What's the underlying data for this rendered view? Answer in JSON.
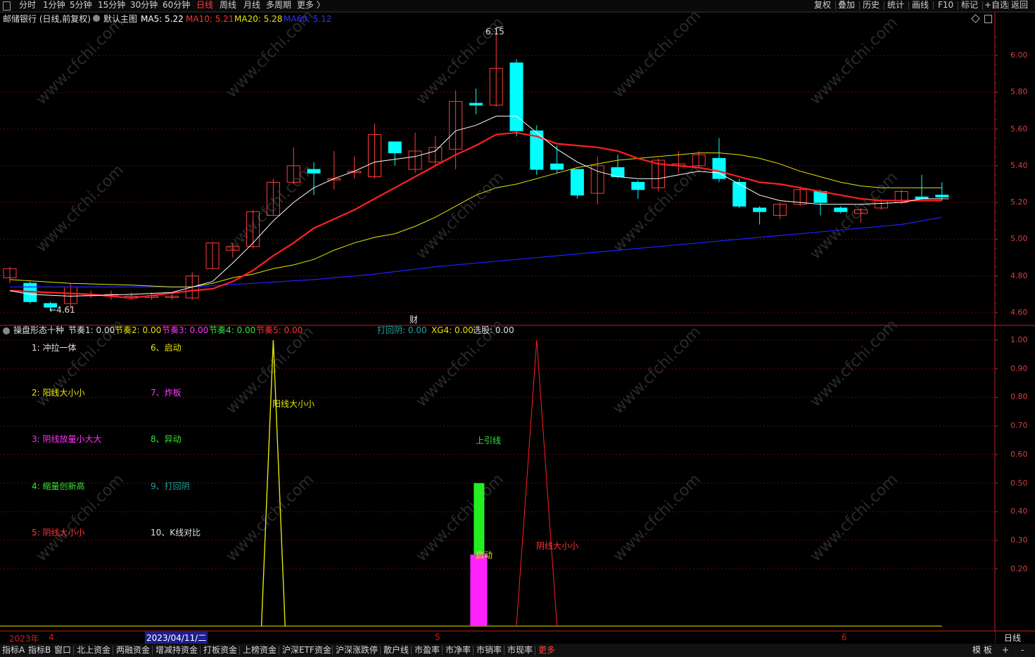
{
  "toolbar": {
    "periods": [
      "分时",
      "1分钟",
      "5分钟",
      "15分钟",
      "30分钟",
      "60分钟",
      "日线",
      "周线",
      "月线",
      "多周期",
      "更多 〉"
    ],
    "active_period": "日线",
    "right_buttons": [
      "复权",
      "叠加",
      "历史",
      "统计",
      "画线",
      "F10",
      "标记",
      "+自选",
      "返回"
    ]
  },
  "main_chart": {
    "stock_title": "邮储银行 (日线,前复权)",
    "template": "默认主图",
    "ma5": "MA5: 5.22",
    "ma10": "MA10: 5.21",
    "ma20": "MA20: 5.28",
    "ma60": "MA60: 5.12",
    "high_mark": "6.15",
    "low_mark": "4.61",
    "fin_marker": "财"
  },
  "indicator": {
    "title": "操盘形态十种",
    "jz1": "节奏1: 0.00",
    "jz2": "节奏2: 0.00",
    "jz3": "节奏3: 0.00",
    "jz4": "节奏4: 0.00",
    "jz5": "节奏5: 0.00",
    "dhy": "打回阴: 0.00",
    "xg4": "XG4: 0.00",
    "xg": "选股: 0.00",
    "legend": [
      {
        "text": "1: 冲拉一体",
        "color": "#e0e0e0"
      },
      {
        "text": "2: 阳线大小小",
        "color": "#e6e600"
      },
      {
        "text": "3: 阴线放量小大大",
        "color": "#ff33ff"
      },
      {
        "text": "4: 缩量创新高",
        "color": "#33e633"
      },
      {
        "text": "5: 阴线大小小",
        "color": "#ff3333"
      },
      {
        "text": "6、启动",
        "color": "#e6e600"
      },
      {
        "text": "7、炸板",
        "color": "#ff33ff"
      },
      {
        "text": "8、异动",
        "color": "#33e633"
      },
      {
        "text": "9、打回阴",
        "color": "#20a0a0"
      },
      {
        "text": "10、K线对比",
        "color": "#e0e0e0"
      }
    ],
    "signals": {
      "yang": "阳线大小小",
      "shangyin": "上引线",
      "qidong": "启动",
      "yin": "阴线大小小"
    }
  },
  "axes": {
    "price_ticks": [
      "6.00",
      "5.80",
      "5.60",
      "5.40",
      "5.20",
      "5.00",
      "4.80",
      "4.60"
    ],
    "ind_ticks": [
      "1.00",
      "0.90",
      "0.80",
      "0.70",
      "0.60",
      "0.50",
      "0.40",
      "0.30",
      "0.20"
    ]
  },
  "date_axis": {
    "year": "2023年",
    "m4": "4",
    "cursor_date": "2023/04/11/二",
    "m5": "5",
    "m6": "6",
    "period_label": "日线"
  },
  "bottom_tabs": [
    "指标A",
    "指标B",
    "窗口",
    "北上资金",
    "两融资金",
    "增减持资金",
    "打板资金",
    "上榜资金",
    "沪深ETF资金",
    "沪深涨跌停",
    "散户线",
    "市盈率",
    "市净率",
    "市销率",
    "市现率",
    "更多"
  ],
  "bottom_right": [
    "模 板",
    "+",
    "-"
  ],
  "watermark": "www.cfchi.com",
  "colors": {
    "bull": "#ff3c3c",
    "bear": "#00ffff",
    "ma5": "#ffffff",
    "ma10": "#ff2020",
    "ma20": "#e6e600",
    "ma60": "#2020ff",
    "axis": "#c81e1e"
  },
  "chart_data": [
    {
      "type": "candlestick",
      "title": "邮储银行 (日线,前复权)",
      "ylim": [
        4.55,
        6.2
      ],
      "candles": [
        {
          "o": 4.79,
          "c": 4.84,
          "h": 4.85,
          "l": 4.76
        },
        {
          "o": 4.76,
          "c": 4.66,
          "h": 4.77,
          "l": 4.65
        },
        {
          "o": 4.65,
          "c": 4.63,
          "h": 4.66,
          "l": 4.61
        },
        {
          "o": 4.65,
          "c": 4.74,
          "h": 4.76,
          "l": 4.62
        },
        {
          "o": 4.7,
          "c": 4.7,
          "h": 4.72,
          "l": 4.68
        },
        {
          "o": 4.69,
          "c": 4.7,
          "h": 4.72,
          "l": 4.67
        },
        {
          "o": 4.68,
          "c": 4.69,
          "h": 4.71,
          "l": 4.67
        },
        {
          "o": 4.69,
          "c": 4.69,
          "h": 4.71,
          "l": 4.67
        },
        {
          "o": 4.69,
          "c": 4.69,
          "h": 4.71,
          "l": 4.67
        },
        {
          "o": 4.68,
          "c": 4.8,
          "h": 4.82,
          "l": 4.67
        },
        {
          "o": 4.84,
          "c": 4.98,
          "h": 4.98,
          "l": 4.84
        },
        {
          "o": 4.94,
          "c": 4.96,
          "h": 4.98,
          "l": 4.9
        },
        {
          "o": 4.96,
          "c": 5.15,
          "h": 5.16,
          "l": 4.95
        },
        {
          "o": 5.13,
          "c": 5.31,
          "h": 5.33,
          "l": 5.13
        },
        {
          "o": 5.31,
          "c": 5.4,
          "h": 5.5,
          "l": 5.3
        },
        {
          "o": 5.38,
          "c": 5.36,
          "h": 5.42,
          "l": 5.24
        },
        {
          "o": 5.33,
          "c": 5.33,
          "h": 5.48,
          "l": 5.27
        },
        {
          "o": 5.37,
          "c": 5.37,
          "h": 5.45,
          "l": 5.33
        },
        {
          "o": 5.34,
          "c": 5.57,
          "h": 5.63,
          "l": 5.33
        },
        {
          "o": 5.53,
          "c": 5.47,
          "h": 5.53,
          "l": 5.4
        },
        {
          "o": 5.38,
          "c": 5.48,
          "h": 5.58,
          "l": 5.36
        },
        {
          "o": 5.42,
          "c": 5.5,
          "h": 5.56,
          "l": 5.4
        },
        {
          "o": 5.49,
          "c": 5.75,
          "h": 5.81,
          "l": 5.38
        },
        {
          "o": 5.74,
          "c": 5.73,
          "h": 5.82,
          "l": 5.68
        },
        {
          "o": 5.73,
          "c": 5.93,
          "h": 6.15,
          "l": 5.72
        },
        {
          "o": 5.96,
          "c": 5.59,
          "h": 5.98,
          "l": 5.56
        },
        {
          "o": 5.59,
          "c": 5.38,
          "h": 5.62,
          "l": 5.35
        },
        {
          "o": 5.41,
          "c": 5.38,
          "h": 5.51,
          "l": 5.36
        },
        {
          "o": 5.38,
          "c": 5.24,
          "h": 5.38,
          "l": 5.22
        },
        {
          "o": 5.25,
          "c": 5.4,
          "h": 5.45,
          "l": 5.19
        },
        {
          "o": 5.39,
          "c": 5.34,
          "h": 5.46,
          "l": 5.33
        },
        {
          "o": 5.31,
          "c": 5.27,
          "h": 5.32,
          "l": 5.22
        },
        {
          "o": 5.28,
          "c": 5.43,
          "h": 5.44,
          "l": 5.26
        },
        {
          "o": 5.4,
          "c": 5.41,
          "h": 5.48,
          "l": 5.36
        },
        {
          "o": 5.4,
          "c": 5.46,
          "h": 5.48,
          "l": 5.39
        },
        {
          "o": 5.44,
          "c": 5.33,
          "h": 5.55,
          "l": 5.31
        },
        {
          "o": 5.31,
          "c": 5.18,
          "h": 5.33,
          "l": 5.17
        },
        {
          "o": 5.17,
          "c": 5.15,
          "h": 5.18,
          "l": 5.08
        },
        {
          "o": 5.13,
          "c": 5.19,
          "h": 5.2,
          "l": 5.11
        },
        {
          "o": 5.19,
          "c": 5.27,
          "h": 5.29,
          "l": 5.18
        },
        {
          "o": 5.26,
          "c": 5.2,
          "h": 5.27,
          "l": 5.13
        },
        {
          "o": 5.17,
          "c": 5.15,
          "h": 5.18,
          "l": 5.14
        },
        {
          "o": 5.14,
          "c": 5.16,
          "h": 5.17,
          "l": 5.09
        },
        {
          "o": 5.17,
          "c": 5.21,
          "h": 5.22,
          "l": 5.16
        },
        {
          "o": 5.2,
          "c": 5.26,
          "h": 5.27,
          "l": 5.19
        },
        {
          "o": 5.23,
          "c": 5.22,
          "h": 5.35,
          "l": 5.21
        },
        {
          "o": 5.24,
          "c": 5.23,
          "h": 5.31,
          "l": 5.21
        }
      ],
      "ma5": [
        [
          0,
          4.72
        ],
        [
          1,
          4.7
        ],
        [
          3,
          4.69
        ],
        [
          6,
          4.7
        ],
        [
          8,
          4.71
        ],
        [
          10,
          4.77
        ],
        [
          11,
          4.87
        ],
        [
          12,
          4.98
        ],
        [
          13,
          5.1
        ],
        [
          14,
          5.2
        ],
        [
          15,
          5.28
        ],
        [
          16,
          5.33
        ],
        [
          17,
          5.37
        ],
        [
          18,
          5.42
        ],
        [
          20,
          5.45
        ],
        [
          21,
          5.48
        ],
        [
          22,
          5.59
        ],
        [
          23,
          5.62
        ],
        [
          24,
          5.67
        ],
        [
          25,
          5.67
        ],
        [
          26,
          5.58
        ],
        [
          27,
          5.49
        ],
        [
          28,
          5.42
        ],
        [
          29,
          5.37
        ],
        [
          30,
          5.34
        ],
        [
          31,
          5.33
        ],
        [
          32,
          5.33
        ],
        [
          33,
          5.35
        ],
        [
          34,
          5.37
        ],
        [
          35,
          5.36
        ],
        [
          36,
          5.3
        ],
        [
          37,
          5.24
        ],
        [
          38,
          5.21
        ],
        [
          39,
          5.2
        ],
        [
          40,
          5.19
        ],
        [
          42,
          5.19
        ],
        [
          44,
          5.2
        ],
        [
          45,
          5.22
        ],
        [
          46,
          5.22
        ]
      ],
      "ma10": [
        [
          0,
          4.72
        ],
        [
          4,
          4.7
        ],
        [
          6,
          4.68
        ],
        [
          9,
          4.72
        ],
        [
          10,
          4.73
        ],
        [
          11,
          4.77
        ],
        [
          12,
          4.83
        ],
        [
          13,
          4.91
        ],
        [
          14,
          4.98
        ],
        [
          15,
          5.06
        ],
        [
          16,
          5.11
        ],
        [
          17,
          5.16
        ],
        [
          18,
          5.22
        ],
        [
          19,
          5.28
        ],
        [
          20,
          5.34
        ],
        [
          21,
          5.4
        ],
        [
          22,
          5.46
        ],
        [
          23,
          5.51
        ],
        [
          24,
          5.57
        ],
        [
          25,
          5.58
        ],
        [
          26,
          5.56
        ],
        [
          27,
          5.52
        ],
        [
          28,
          5.51
        ],
        [
          29,
          5.5
        ],
        [
          30,
          5.48
        ],
        [
          31,
          5.44
        ],
        [
          32,
          5.41
        ],
        [
          33,
          5.4
        ],
        [
          34,
          5.39
        ],
        [
          35,
          5.37
        ],
        [
          36,
          5.34
        ],
        [
          37,
          5.31
        ],
        [
          38,
          5.3
        ],
        [
          39,
          5.28
        ],
        [
          40,
          5.26
        ],
        [
          41,
          5.24
        ],
        [
          42,
          5.22
        ],
        [
          43,
          5.21
        ],
        [
          44,
          5.21
        ],
        [
          46,
          5.21
        ]
      ],
      "ma20": [
        [
          0,
          4.78
        ],
        [
          3,
          4.76
        ],
        [
          6,
          4.75
        ],
        [
          8,
          4.74
        ],
        [
          9,
          4.74
        ],
        [
          10,
          4.76
        ],
        [
          11,
          4.79
        ],
        [
          12,
          4.81
        ],
        [
          13,
          4.84
        ],
        [
          14,
          4.86
        ],
        [
          15,
          4.89
        ],
        [
          16,
          4.94
        ],
        [
          17,
          4.98
        ],
        [
          18,
          5.01
        ],
        [
          19,
          5.03
        ],
        [
          20,
          5.07
        ],
        [
          21,
          5.12
        ],
        [
          22,
          5.18
        ],
        [
          23,
          5.24
        ],
        [
          24,
          5.28
        ],
        [
          25,
          5.3
        ],
        [
          26,
          5.33
        ],
        [
          27,
          5.36
        ],
        [
          28,
          5.39
        ],
        [
          29,
          5.41
        ],
        [
          30,
          5.43
        ],
        [
          31,
          5.44
        ],
        [
          32,
          5.45
        ],
        [
          33,
          5.46
        ],
        [
          34,
          5.47
        ],
        [
          35,
          5.47
        ],
        [
          36,
          5.46
        ],
        [
          37,
          5.44
        ],
        [
          38,
          5.41
        ],
        [
          39,
          5.37
        ],
        [
          40,
          5.34
        ],
        [
          41,
          5.31
        ],
        [
          42,
          5.29
        ],
        [
          43,
          5.28
        ],
        [
          44,
          5.28
        ],
        [
          46,
          5.28
        ]
      ],
      "ma60": [
        [
          0,
          4.74
        ],
        [
          6,
          4.74
        ],
        [
          9,
          4.74
        ],
        [
          12,
          4.76
        ],
        [
          15,
          4.78
        ],
        [
          18,
          4.81
        ],
        [
          21,
          4.85
        ],
        [
          24,
          4.88
        ],
        [
          27,
          4.91
        ],
        [
          30,
          4.94
        ],
        [
          33,
          4.97
        ],
        [
          36,
          5.0
        ],
        [
          39,
          5.03
        ],
        [
          42,
          5.06
        ],
        [
          44,
          5.08
        ],
        [
          46,
          5.12
        ]
      ]
    },
    {
      "type": "line",
      "title": "操盘形态十种",
      "ylim": [
        0.0,
        1.04
      ],
      "series": [
        {
          "name": "阳线大小小",
          "values": [
            [
              12,
              0
            ],
            [
              13,
              1.0
            ],
            [
              14,
              0
            ]
          ]
        },
        {
          "name": "阴线大小小",
          "values": [
            [
              25,
              0
            ],
            [
              26,
              1.0
            ],
            [
              27,
              0
            ]
          ]
        },
        {
          "name": "上引线",
          "values": [
            [
              23,
              0.5
            ]
          ]
        },
        {
          "name": "启动",
          "values": [
            [
              23,
              0.25
            ]
          ]
        }
      ]
    }
  ]
}
